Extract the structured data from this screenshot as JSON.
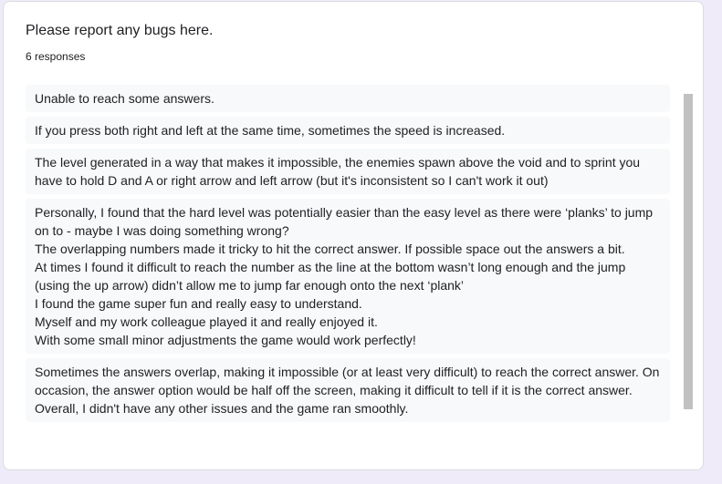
{
  "question": {
    "title": "Please report any bugs here.",
    "response_count": "6 responses"
  },
  "responses": [
    "Unable to reach some answers.",
    "If you press both right and left at the same time, sometimes the speed is increased.",
    "The level generated in a way that makes it impossible, the enemies spawn above the void and to sprint you have to hold D and A or right arrow and left arrow (but it's inconsistent so I can't work it out)",
    "Personally, I found that the hard level was potentially easier than the easy level as there were ‘planks’ to jump on to - maybe I was doing something wrong?\nThe overlapping numbers made it tricky to hit the correct answer. If possible space out the answers a bit.\nAt times I found it difficult to reach the number as the line at the bottom wasn’t long enough and the jump (using the up arrow) didn’t allow me to jump far enough onto the next ‘plank’\nI found the game super fun and really easy to understand.\nMyself and my work colleague played it and really enjoyed it.\nWith some small minor adjustments the game would work perfectly!",
    "Sometimes the answers overlap, making it impossible (or at least very difficult) to reach the correct answer. On occasion, the answer option would be half off the screen, making it difficult to tell if it is the correct answer. Overall, I didn't have any other issues and the game ran smoothly."
  ]
}
